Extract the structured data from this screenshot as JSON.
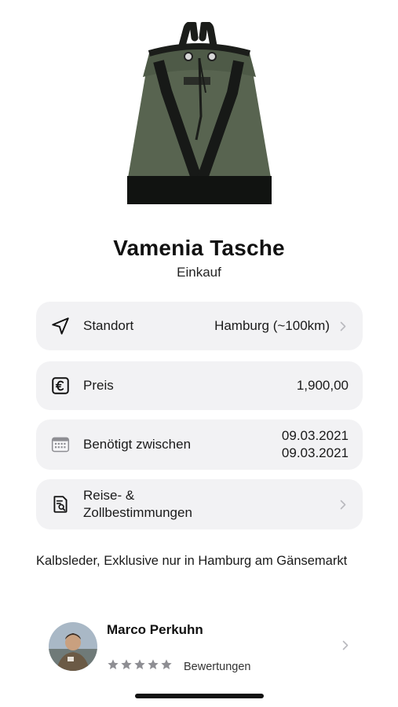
{
  "product": {
    "title": "Vamenia Tasche",
    "subtitle": "Einkauf"
  },
  "details": {
    "location": {
      "label": "Standort",
      "value": "Hamburg (~100km)",
      "icon": "navigation-arrow-icon"
    },
    "price": {
      "label": "Preis",
      "value": "1,900,00",
      "icon": "euro-icon"
    },
    "needed": {
      "label": "Benötigt zwischen",
      "date_from": "09.03.2021",
      "date_to": "09.03.2021",
      "icon": "calendar-icon"
    },
    "regulations": {
      "label_line1": "Reise- &",
      "label_line2": "Zollbestimmungen",
      "icon": "document-search-icon"
    }
  },
  "description": "Kalbsleder, Exklusive nur in Hamburg am Gänsemarkt",
  "seller": {
    "name": "Marco Perkuhn",
    "rating": 5,
    "rating_max": 5,
    "reviews_label": "Bewertungen"
  },
  "colors": {
    "card_bg": "#f2f2f4",
    "star": "#8e8e93",
    "chevron": "#b9b9be"
  }
}
